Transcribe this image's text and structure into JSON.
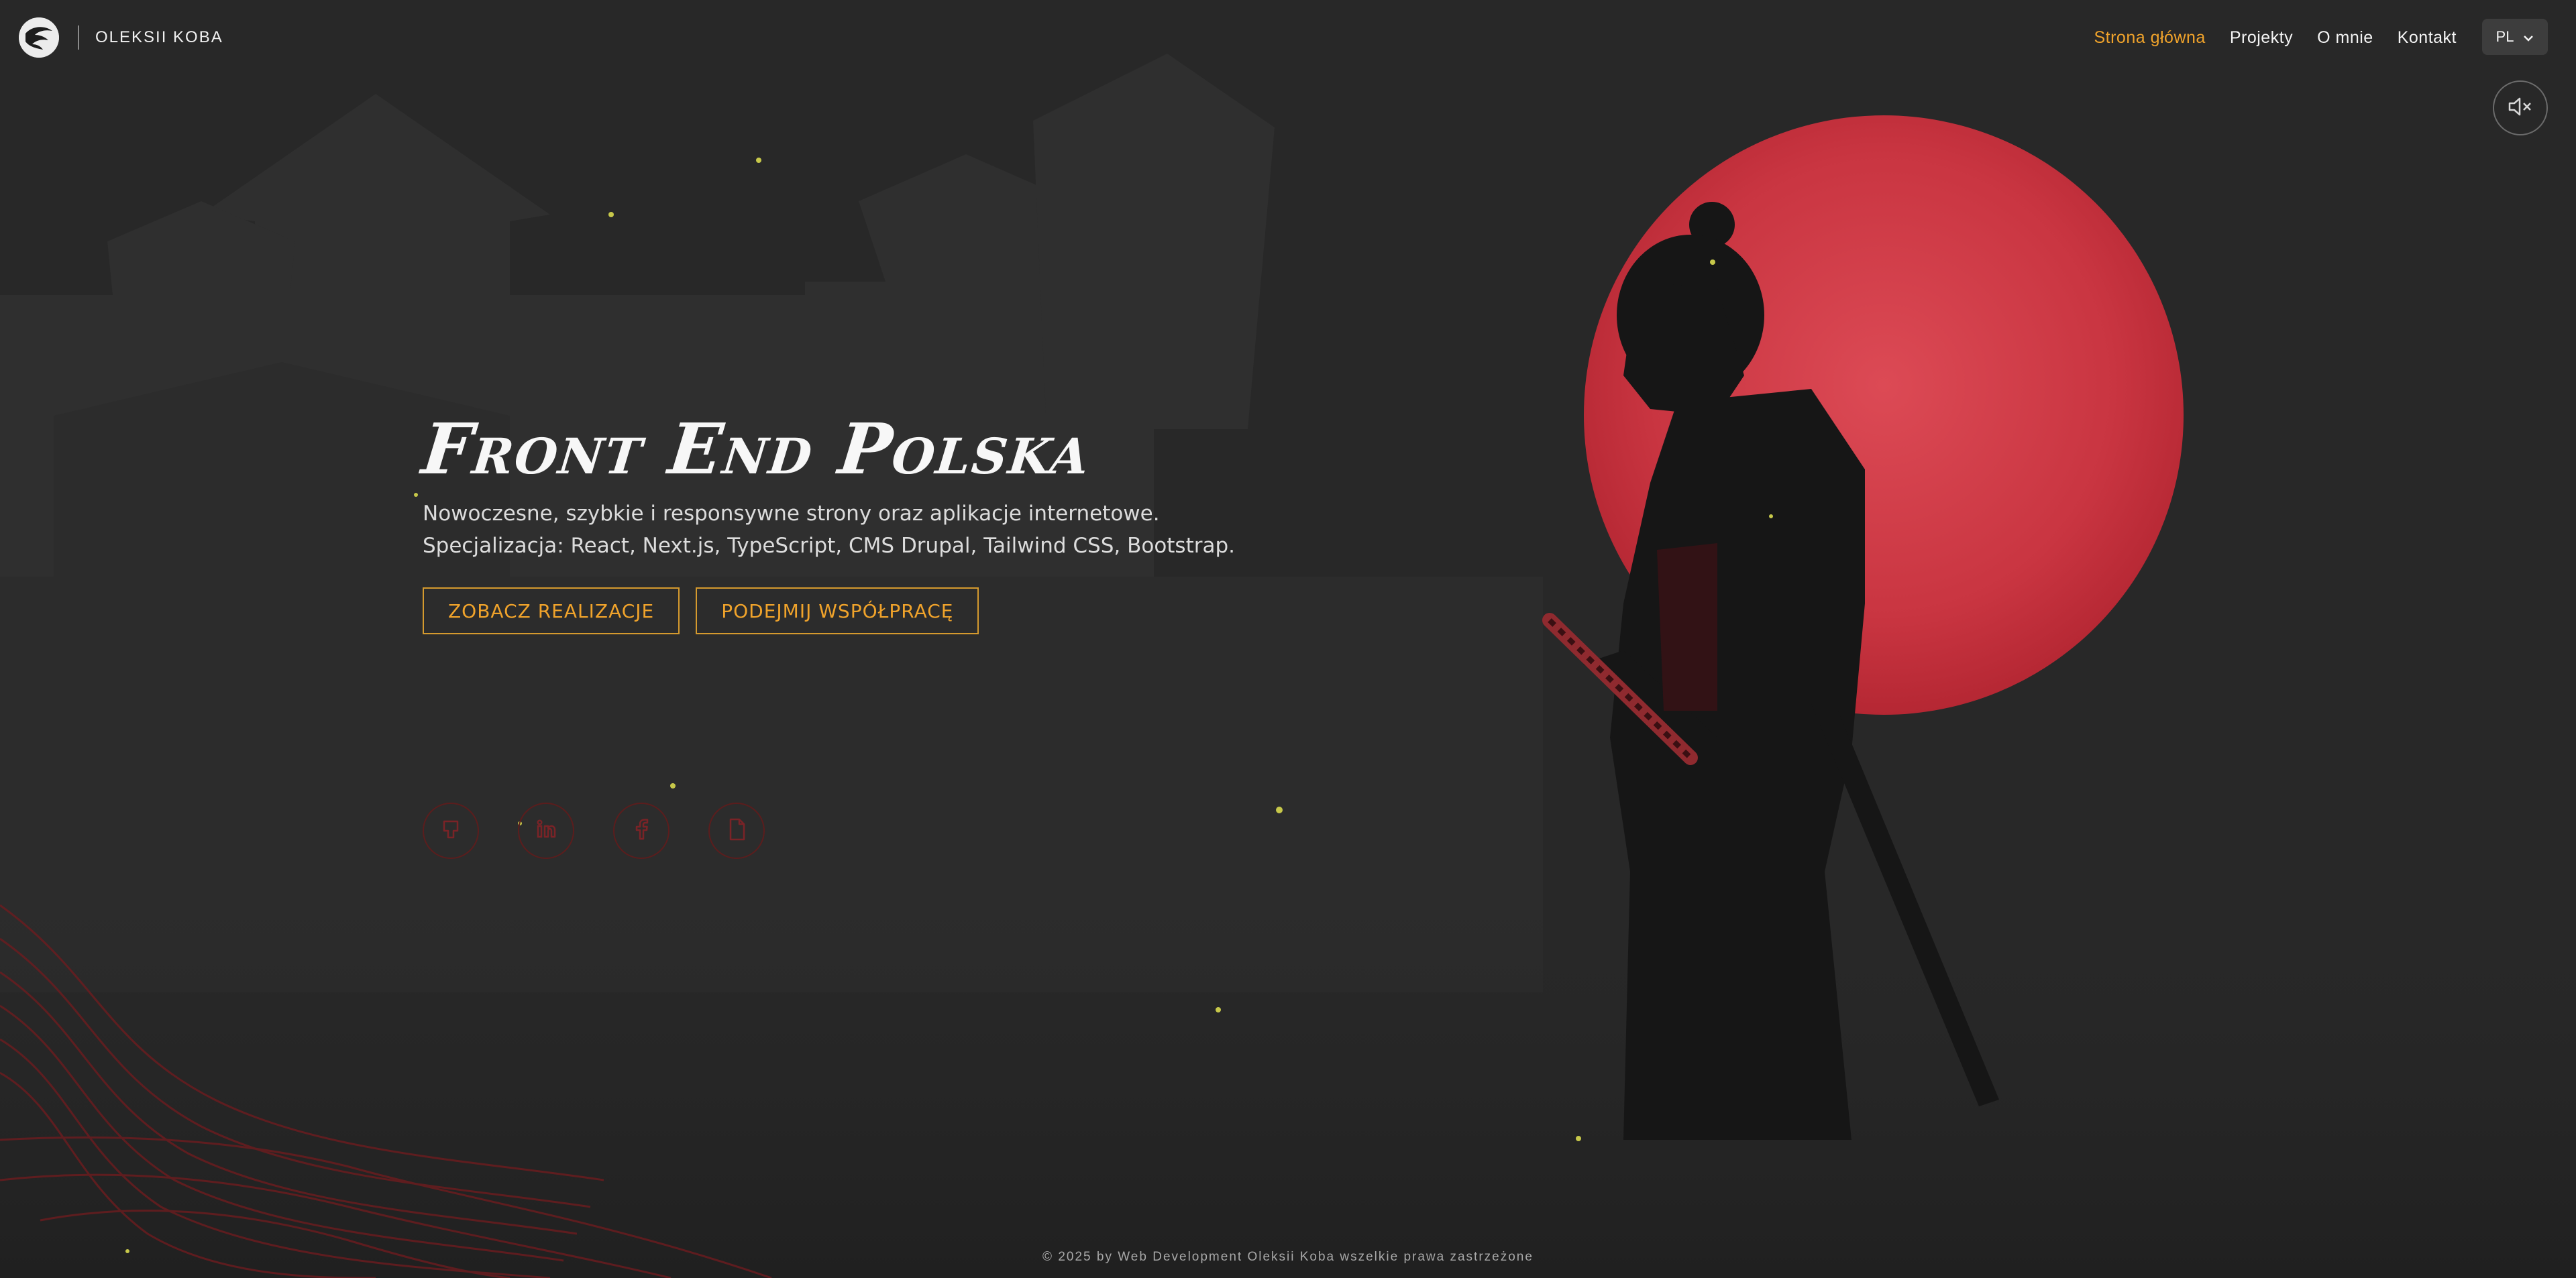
{
  "header": {
    "brand": "OLEKSII KOBA",
    "nav": [
      {
        "label": "Strona główna",
        "active": true
      },
      {
        "label": "Projekty"
      },
      {
        "label": "O mnie"
      },
      {
        "label": "Kontakt"
      }
    ],
    "language": "PL",
    "icons": {
      "logo": "samurai-logo",
      "language": "chevron-down-icon",
      "sound": "speaker-muted-icon"
    }
  },
  "hero": {
    "title": "Front End Polska",
    "line1": "Nowoczesne, szybkie i responsywne strony oraz aplikacje internetowe.",
    "line2": "Specjalizacja: React, Next.js, TypeScript, CMS Drupal, Tailwind CSS, Bootstrap.",
    "buttons": {
      "projects": "ZOBACZ REALIZACJE",
      "cooperation": "PODEJMIJ WSPÓŁPRACĘ"
    }
  },
  "socials": [
    "github-icon",
    "linkedin-icon",
    "facebook-icon",
    "cv-document-icon"
  ],
  "footer": {
    "copyright": "© 2025 by Web Development Oleksii Koba wszelkie prawa zastrzeżone"
  },
  "colors": {
    "accent": "#f0a32b",
    "moon": "#c9313b",
    "background": "#282828",
    "social_border": "#5b1d1d"
  }
}
